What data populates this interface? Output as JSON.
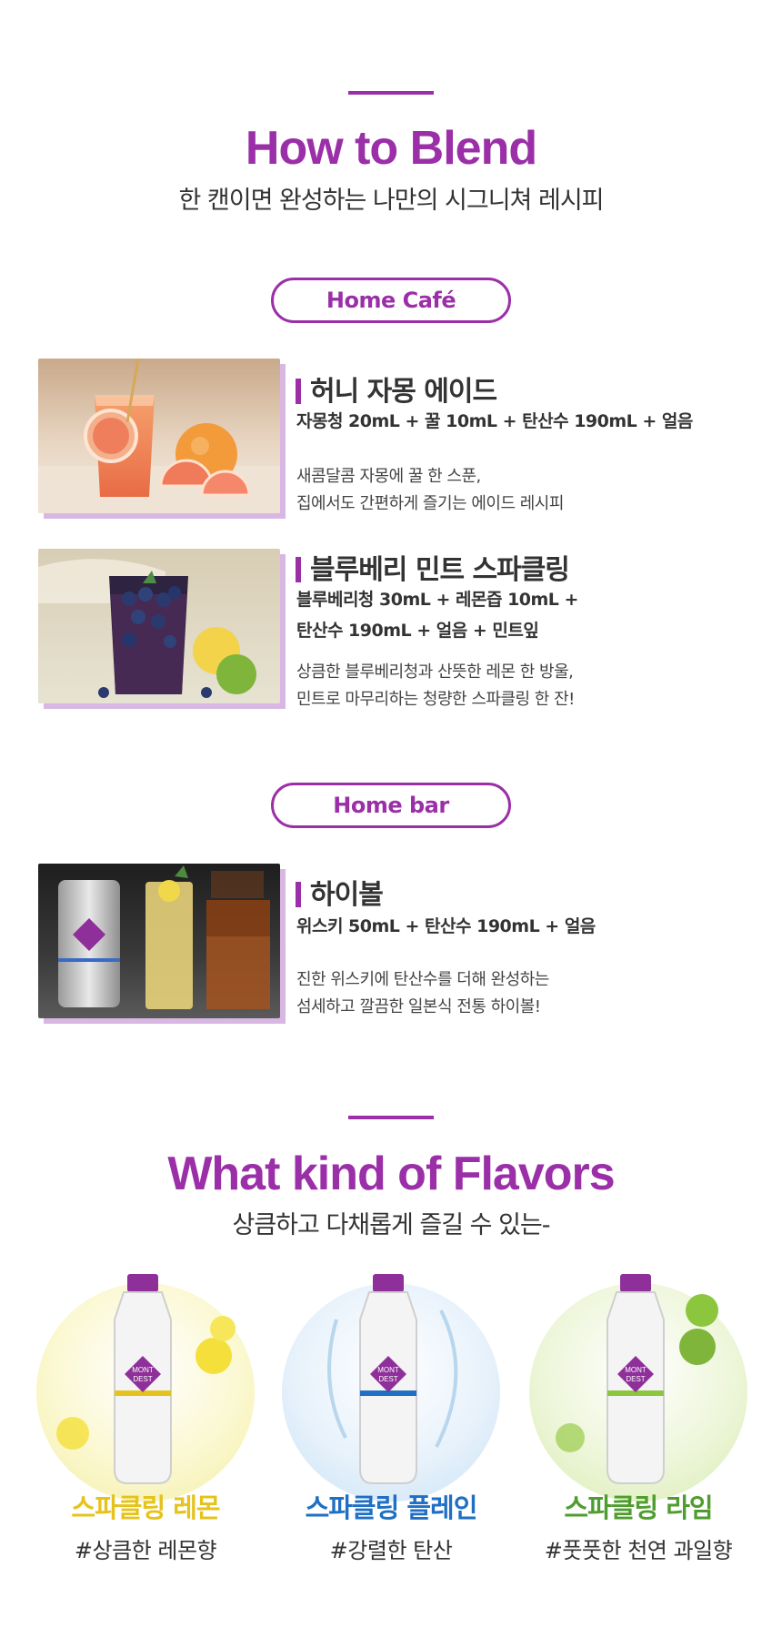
{
  "how_to": {
    "title": "How to Blend",
    "subtitle": "한 캔이면 완성하는 나만의 시그니쳐 레시피"
  },
  "home_cafe": {
    "label": "Home Café",
    "recipes": [
      {
        "title": "허니 자몽 에이드",
        "ingredients": [
          "자몽청 20mL +  꿀 10mL + 탄산수 190mL + 얼음"
        ],
        "desc": [
          "새콤달콤 자몽에 꿀 한 스푼,",
          "집에서도 간편하게 즐기는 에이드 레시피"
        ]
      },
      {
        "title": "블루베리  민트 스파클링",
        "ingredients": [
          "블루베리청 30mL + 레몬즙 10mL +",
          "탄산수 190mL + 얼음 + 민트잎"
        ],
        "desc": [
          "상큼한 블루베리청과 산뜻한 레몬 한 방울,",
          "민트로 마무리하는 청량한 스파클링 한 잔!"
        ]
      }
    ]
  },
  "home_bar": {
    "label": "Home bar",
    "recipes": [
      {
        "title": "하이볼",
        "ingredients": [
          "위스키 50mL + 탄산수 190mL + 얼음"
        ],
        "desc": [
          "진한 위스키에 탄산수를 더해  완성하는",
          "섬세하고 깔끔한 일본식 전통 하이볼!"
        ]
      }
    ]
  },
  "flavors": {
    "title": "What kind of Flavors",
    "subtitle": "상큼하고 다채롭게 즐길 수 있는-",
    "items": [
      {
        "name": "스파클링 레몬",
        "tag": "#상큼한 레몬향",
        "color": "#e5c31c"
      },
      {
        "name": "스파클링 플레인",
        "tag": "#강렬한 탄산",
        "color": "#1f6fc4"
      },
      {
        "name": "스파클링 라임",
        "tag": "#풋풋한 천연 과일향",
        "color": "#4f9d2f"
      }
    ],
    "bottle_logo": [
      "MONT",
      "DEST"
    ]
  }
}
